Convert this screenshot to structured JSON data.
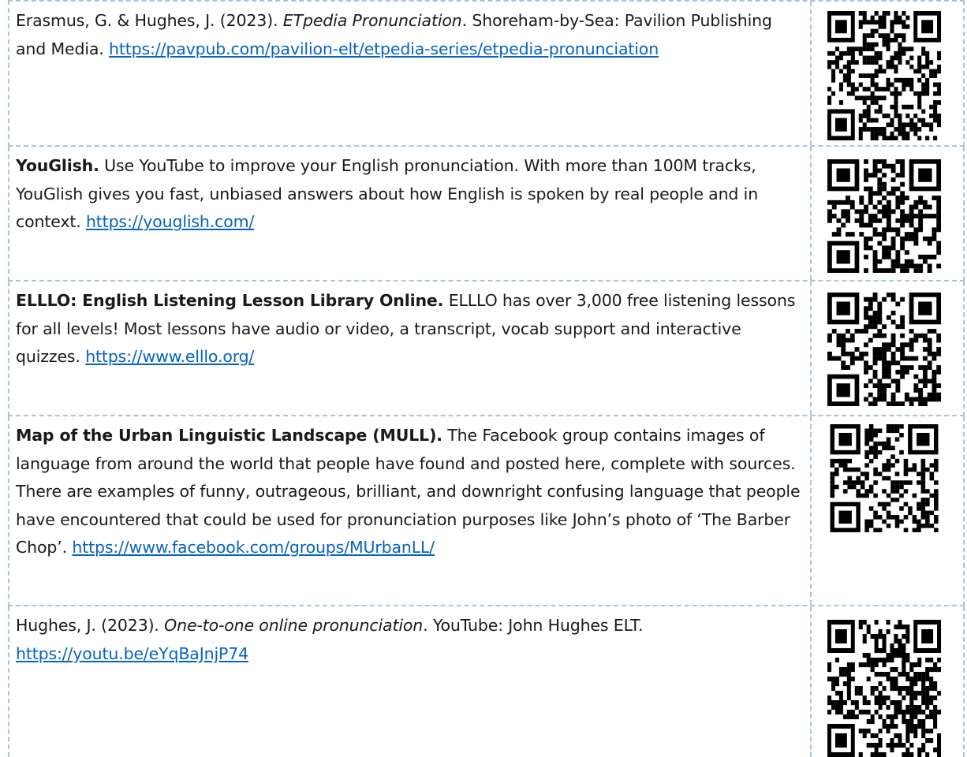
{
  "entries": [
    {
      "pre": "Erasmus, G. & Hughes, J. (2023). ",
      "italic": "ETpedia Pronunciation",
      "post": ". Shoreham-by-Sea: Pavilion Publishing and Media. ",
      "url": "https://pavpub.com/pavilion-elt/etpedia-series/etpedia-pronunciation",
      "qr_icon": "qr-code-icon"
    },
    {
      "bold": "YouGlish.",
      "text": " Use YouTube to improve your English pronunciation. With more than 100M tracks, YouGlish gives you fast, unbiased answers about how English is spoken by real people and in context. ",
      "url": "https://youglish.com/",
      "qr_icon": "qr-code-icon"
    },
    {
      "bold": "ELLLO: English Listening Lesson Library Online.",
      "text": " ELLLO has over 3,000 free listening lessons for all levels! Most lessons have audio or video, a transcript, vocab support and interactive quizzes. ",
      "url": "https://www.elllo.org/",
      "qr_icon": "qr-code-icon"
    },
    {
      "bold": "Map of the Urban Linguistic Landscape (MULL).",
      "text": " The Facebook group contains images of language from around the world that people have found and posted here, complete with sources. There are examples of funny, outrageous, brilliant, and downright confusing language that people have encountered that could be used for pronunciation purposes like John’s photo of ‘The Barber Chop’. ",
      "url": "https://www.facebook.com/groups/MUrbanLL/",
      "qr_icon": "qr-code-icon"
    },
    {
      "pre": "Hughes, J. (2023). ",
      "italic": "One-to-one online pronunciation",
      "post": ". YouTube: John Hughes ELT. ",
      "url": "https://youtu.be/eYqBaJnjP74",
      "qr_icon": "qr-code-icon"
    }
  ]
}
